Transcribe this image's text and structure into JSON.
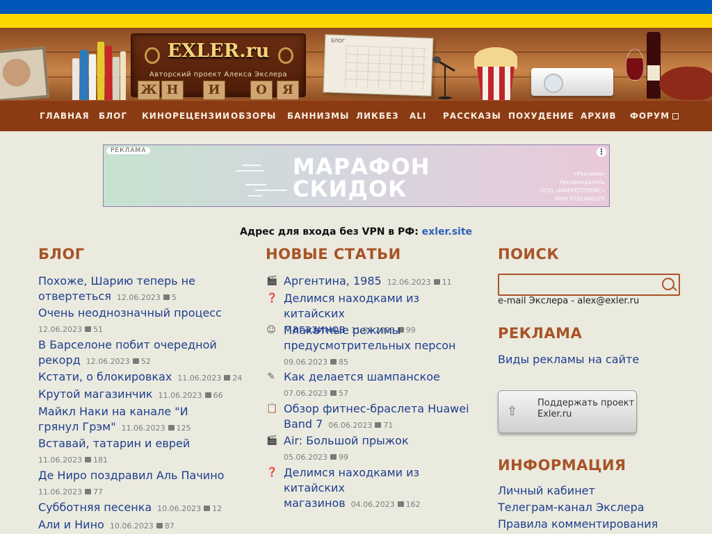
{
  "site": {
    "logo_title": "EXLER.ru",
    "logo_subtitle": "Авторский проект Алекса Экслера",
    "calendar_label": "БЛОГ"
  },
  "colors": {
    "flag_blue": "#0057b7",
    "flag_yellow": "#ffd700",
    "nav_bg": "#8b3b14",
    "heading": "#a85327",
    "link": "#1d3e8e"
  },
  "nav": [
    "ГЛАВНАЯ",
    "БЛОГ",
    "КИНОРЕЦЕНЗИИ",
    "ОБЗОРЫ",
    "БАННИЗМЫ",
    "ЛИКБЕЗ",
    "ALI",
    "РАССКАЗЫ",
    "ПОХУДЕНИЕ",
    "АРХИВ",
    "ФОРУМ"
  ],
  "ad": {
    "tag": "РЕКЛАМА",
    "line1": "МАРАФОН",
    "line2": "СКИДОК",
    "legal": [
      "«Реклама»",
      "Рекламодатель",
      "ООО «МАРКЕТПЛЕЙС»",
      "ИНН 9701048328"
    ]
  },
  "vpn": {
    "text": "Адрес для входа без VPN в РФ:",
    "link": "exler.site"
  },
  "blog": {
    "heading": "БЛОГ",
    "items": [
      {
        "title": "Похоже, Шарию теперь не отвертеться",
        "date": "12.06.2023",
        "comments": "5"
      },
      {
        "title": "Очень неоднозначный процесс",
        "date": "12.06.2023",
        "comments": "51"
      },
      {
        "title": "В Барселоне побит очередной рекорд",
        "date": "12.06.2023",
        "comments": "52"
      },
      {
        "title": "Кстати, о блокировках",
        "date": "11.06.2023",
        "comments": "24"
      },
      {
        "title": "Крутой магазинчик",
        "date": "11.06.2023",
        "comments": "66"
      },
      {
        "title": "Майкл Наки на канале \"И грянул Грэм\"",
        "date": "11.06.2023",
        "comments": "125"
      },
      {
        "title": "Вставай, татарин и еврей",
        "date": "11.06.2023",
        "comments": "181"
      },
      {
        "title": "Де Ниро поздравил Аль Пачино",
        "date": "11.06.2023",
        "comments": "77"
      },
      {
        "title": "Субботняя песенка",
        "date": "10.06.2023",
        "comments": "12"
      },
      {
        "title": "Али и Нино",
        "date": "10.06.2023",
        "comments": "87"
      }
    ]
  },
  "articles": {
    "heading": "НОВЫЕ СТАТЬИ",
    "items": [
      {
        "icon": "clapperboard-icon",
        "title": "Аргентина, 1985",
        "date": "12.06.2023",
        "comments": "11"
      },
      {
        "icon": "question-icon",
        "title": "Делимся находками из китайских магазинов",
        "date": "11.06.2023",
        "comments": "99"
      },
      {
        "icon": "smiley-icon",
        "title": "Плакатные режимы предусмотрительных персон",
        "date": "09.06.2023",
        "comments": "85"
      },
      {
        "icon": "pencil-icon",
        "title": "Как делается шампанское",
        "date": "07.06.2023",
        "comments": "57"
      },
      {
        "icon": "clipboard-check-icon",
        "title": "Обзор фитнес-браслета Huawei Band 7",
        "date": "06.06.2023",
        "comments": "71"
      },
      {
        "icon": "clapperboard-icon",
        "title": "Air: Большой прыжок",
        "date": "05.06.2023",
        "comments": "99"
      },
      {
        "icon": "question-icon",
        "title": "Делимся находками из китайских магазинов",
        "date": "04.06.2023",
        "comments": "162"
      }
    ]
  },
  "search": {
    "heading": "ПОИСК",
    "placeholder": "",
    "email": "e-mail Экслера - alex@exler.ru"
  },
  "ads_section": {
    "heading": "РЕКЛАМА",
    "link": "Виды рекламы на сайте"
  },
  "support": {
    "label": "Поддержать проект Exler.ru"
  },
  "info": {
    "heading": "ИНФОРМАЦИЯ",
    "links": [
      "Личный кабинет",
      "Телеграм-канал Экслера",
      "Правила комментирования"
    ]
  }
}
